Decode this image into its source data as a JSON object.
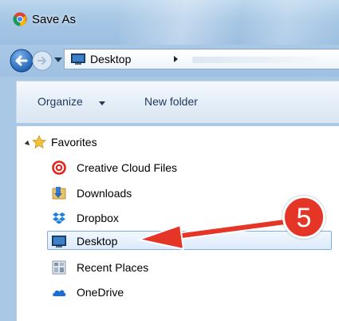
{
  "window": {
    "title": "Save As"
  },
  "address": {
    "location": "Desktop"
  },
  "toolbar": {
    "organize_label": "Organize",
    "new_folder_label": "New folder"
  },
  "nav": {
    "favorites_label": "Favorites",
    "items": [
      {
        "label": "Creative Cloud Files",
        "icon": "creative-cloud-icon"
      },
      {
        "label": "Downloads",
        "icon": "downloads-folder-icon"
      },
      {
        "label": "Dropbox",
        "icon": "dropbox-icon"
      },
      {
        "label": "Desktop",
        "icon": "desktop-icon",
        "selected": true
      },
      {
        "label": "Recent Places",
        "icon": "recent-places-icon"
      },
      {
        "label": "OneDrive",
        "icon": "onedrive-icon"
      }
    ]
  },
  "annotation": {
    "step": "5",
    "color": "#e53527"
  },
  "colors": {
    "selection_border": "#84acdd",
    "frame": "#a9c8e6"
  }
}
